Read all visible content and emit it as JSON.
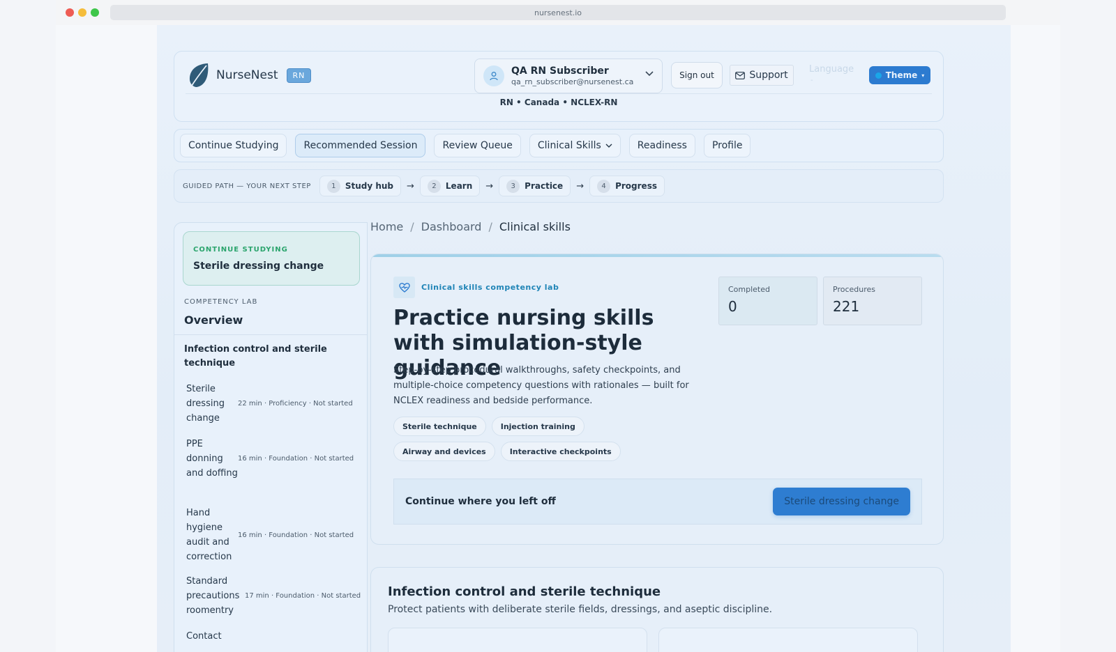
{
  "browser": {
    "url": "nursenest.io"
  },
  "header": {
    "brand": "NurseNest",
    "badge": "RN",
    "user_name": "QA RN Subscriber",
    "user_email": "qa_rn_subscriber@nursenest.ca",
    "sign_out": "Sign out",
    "support": "Support",
    "language": "Language",
    "language_sub": "-",
    "theme": "Theme",
    "theme_arrow": "▾",
    "context": "RN • Canada • NCLEX-RN"
  },
  "nav": [
    {
      "label": "Continue Studying"
    },
    {
      "label": "Recommended Session",
      "active": true
    },
    {
      "label": "Review Queue"
    },
    {
      "label": "Clinical Skills",
      "has_menu": true
    },
    {
      "label": "Readiness"
    },
    {
      "label": "Profile"
    }
  ],
  "guided": {
    "label": "GUIDED PATH — YOUR NEXT STEP",
    "steps": [
      {
        "num": "1",
        "label": "Study hub"
      },
      {
        "num": "2",
        "label": "Learn"
      },
      {
        "num": "3",
        "label": "Practice"
      },
      {
        "num": "4",
        "label": "Progress"
      }
    ],
    "arrow": "→"
  },
  "sidebar": {
    "continue_label": "CONTINUE STUDYING",
    "continue_title": "Sterile dressing change",
    "lab_label": "COMPETENCY LAB",
    "lab_title": "Overview",
    "section": "Infection control and sterile technique",
    "skills": [
      {
        "name": "Sterile dressing change",
        "meta": "22 min · Proficiency · Not started"
      },
      {
        "name": "PPE donning and doffing",
        "meta": "16 min · Foundation · Not started"
      },
      {
        "name": "Hand hygiene audit and correction",
        "meta": "16 min · Foundation · Not started"
      },
      {
        "name": "Standard precautions roomentry",
        "meta": "17 min · Foundation · Not started"
      },
      {
        "name": "Contact",
        "meta": ""
      }
    ]
  },
  "breadcrumb": {
    "home": "Home",
    "dashboard": "Dashboard",
    "current": "Clinical skills",
    "sep": "/"
  },
  "hero": {
    "tag": "Clinical skills competency lab",
    "title": "Practice nursing skills with simulation-style guidance",
    "description": "Step-by-step procedural walkthroughs, safety checkpoints, and multiple-choice competency questions with rationales — built for NCLEX readiness and bedside performance.",
    "chips": [
      "Sterile technique",
      "Injection training",
      "Airway and devices",
      "Interactive checkpoints"
    ],
    "stats": [
      {
        "label": "Completed",
        "value": "0"
      },
      {
        "label": "Procedures",
        "value": "221"
      }
    ],
    "resume_text": "Continue where you left off",
    "resume_button": "Sterile dressing change"
  },
  "section": {
    "title": "Infection control and sterile technique",
    "description": "Protect patients with deliberate sterile fields, dressings, and aseptic discipline."
  }
}
